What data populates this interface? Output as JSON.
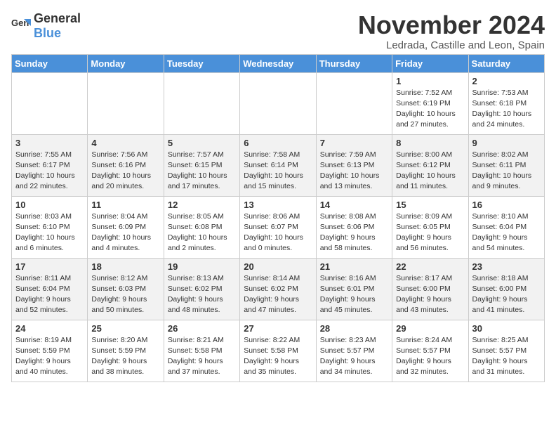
{
  "logo": {
    "general": "General",
    "blue": "Blue"
  },
  "header": {
    "month": "November 2024",
    "location": "Ledrada, Castille and Leon, Spain"
  },
  "weekdays": [
    "Sunday",
    "Monday",
    "Tuesday",
    "Wednesday",
    "Thursday",
    "Friday",
    "Saturday"
  ],
  "weeks": [
    [
      {
        "day": "",
        "info": ""
      },
      {
        "day": "",
        "info": ""
      },
      {
        "day": "",
        "info": ""
      },
      {
        "day": "",
        "info": ""
      },
      {
        "day": "",
        "info": ""
      },
      {
        "day": "1",
        "info": "Sunrise: 7:52 AM\nSunset: 6:19 PM\nDaylight: 10 hours\nand 27 minutes."
      },
      {
        "day": "2",
        "info": "Sunrise: 7:53 AM\nSunset: 6:18 PM\nDaylight: 10 hours\nand 24 minutes."
      }
    ],
    [
      {
        "day": "3",
        "info": "Sunrise: 7:55 AM\nSunset: 6:17 PM\nDaylight: 10 hours\nand 22 minutes."
      },
      {
        "day": "4",
        "info": "Sunrise: 7:56 AM\nSunset: 6:16 PM\nDaylight: 10 hours\nand 20 minutes."
      },
      {
        "day": "5",
        "info": "Sunrise: 7:57 AM\nSunset: 6:15 PM\nDaylight: 10 hours\nand 17 minutes."
      },
      {
        "day": "6",
        "info": "Sunrise: 7:58 AM\nSunset: 6:14 PM\nDaylight: 10 hours\nand 15 minutes."
      },
      {
        "day": "7",
        "info": "Sunrise: 7:59 AM\nSunset: 6:13 PM\nDaylight: 10 hours\nand 13 minutes."
      },
      {
        "day": "8",
        "info": "Sunrise: 8:00 AM\nSunset: 6:12 PM\nDaylight: 10 hours\nand 11 minutes."
      },
      {
        "day": "9",
        "info": "Sunrise: 8:02 AM\nSunset: 6:11 PM\nDaylight: 10 hours\nand 9 minutes."
      }
    ],
    [
      {
        "day": "10",
        "info": "Sunrise: 8:03 AM\nSunset: 6:10 PM\nDaylight: 10 hours\nand 6 minutes."
      },
      {
        "day": "11",
        "info": "Sunrise: 8:04 AM\nSunset: 6:09 PM\nDaylight: 10 hours\nand 4 minutes."
      },
      {
        "day": "12",
        "info": "Sunrise: 8:05 AM\nSunset: 6:08 PM\nDaylight: 10 hours\nand 2 minutes."
      },
      {
        "day": "13",
        "info": "Sunrise: 8:06 AM\nSunset: 6:07 PM\nDaylight: 10 hours\nand 0 minutes."
      },
      {
        "day": "14",
        "info": "Sunrise: 8:08 AM\nSunset: 6:06 PM\nDaylight: 9 hours\nand 58 minutes."
      },
      {
        "day": "15",
        "info": "Sunrise: 8:09 AM\nSunset: 6:05 PM\nDaylight: 9 hours\nand 56 minutes."
      },
      {
        "day": "16",
        "info": "Sunrise: 8:10 AM\nSunset: 6:04 PM\nDaylight: 9 hours\nand 54 minutes."
      }
    ],
    [
      {
        "day": "17",
        "info": "Sunrise: 8:11 AM\nSunset: 6:04 PM\nDaylight: 9 hours\nand 52 minutes."
      },
      {
        "day": "18",
        "info": "Sunrise: 8:12 AM\nSunset: 6:03 PM\nDaylight: 9 hours\nand 50 minutes."
      },
      {
        "day": "19",
        "info": "Sunrise: 8:13 AM\nSunset: 6:02 PM\nDaylight: 9 hours\nand 48 minutes."
      },
      {
        "day": "20",
        "info": "Sunrise: 8:14 AM\nSunset: 6:02 PM\nDaylight: 9 hours\nand 47 minutes."
      },
      {
        "day": "21",
        "info": "Sunrise: 8:16 AM\nSunset: 6:01 PM\nDaylight: 9 hours\nand 45 minutes."
      },
      {
        "day": "22",
        "info": "Sunrise: 8:17 AM\nSunset: 6:00 PM\nDaylight: 9 hours\nand 43 minutes."
      },
      {
        "day": "23",
        "info": "Sunrise: 8:18 AM\nSunset: 6:00 PM\nDaylight: 9 hours\nand 41 minutes."
      }
    ],
    [
      {
        "day": "24",
        "info": "Sunrise: 8:19 AM\nSunset: 5:59 PM\nDaylight: 9 hours\nand 40 minutes."
      },
      {
        "day": "25",
        "info": "Sunrise: 8:20 AM\nSunset: 5:59 PM\nDaylight: 9 hours\nand 38 minutes."
      },
      {
        "day": "26",
        "info": "Sunrise: 8:21 AM\nSunset: 5:58 PM\nDaylight: 9 hours\nand 37 minutes."
      },
      {
        "day": "27",
        "info": "Sunrise: 8:22 AM\nSunset: 5:58 PM\nDaylight: 9 hours\nand 35 minutes."
      },
      {
        "day": "28",
        "info": "Sunrise: 8:23 AM\nSunset: 5:57 PM\nDaylight: 9 hours\nand 34 minutes."
      },
      {
        "day": "29",
        "info": "Sunrise: 8:24 AM\nSunset: 5:57 PM\nDaylight: 9 hours\nand 32 minutes."
      },
      {
        "day": "30",
        "info": "Sunrise: 8:25 AM\nSunset: 5:57 PM\nDaylight: 9 hours\nand 31 minutes."
      }
    ]
  ]
}
